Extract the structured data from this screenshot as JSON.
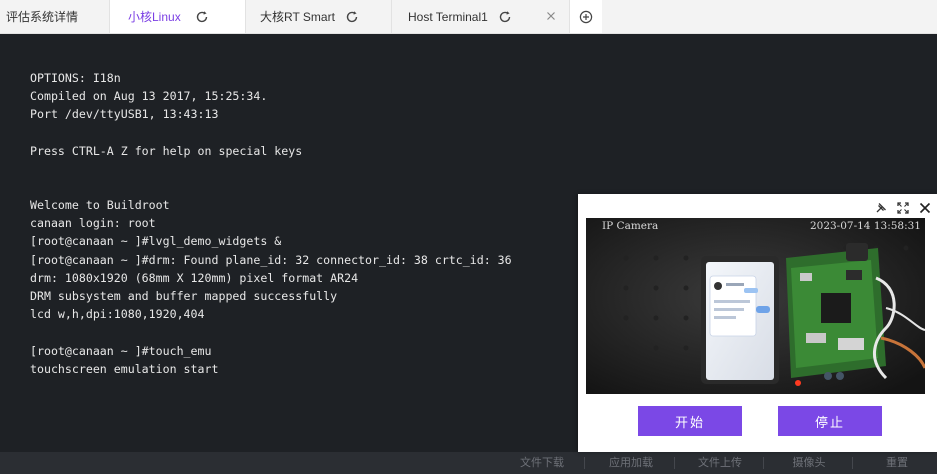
{
  "tabs": [
    {
      "label": "评估系统详情"
    },
    {
      "label": "小核Linux"
    },
    {
      "label": "大核RT Smart"
    },
    {
      "label": "Host Terminal1"
    }
  ],
  "terminal": {
    "lines": [
      "OPTIONS: I18n",
      "Compiled on Aug 13 2017, 15:25:34.",
      "Port /dev/ttyUSB1, 13:43:13",
      "",
      "Press CTRL-A Z for help on special keys",
      "",
      "",
      "Welcome to Buildroot",
      "canaan login: root",
      "[root@canaan ~ ]#lvgl_demo_widgets &",
      "[root@canaan ~ ]#drm: Found plane_id: 32 connector_id: 38 crtc_id: 36",
      "drm: 1080x1920 (68mm X 120mm) pixel format AR24",
      "DRM subsystem and buffer mapped successfully",
      "lcd w,h,dpi:1080,1920,404",
      "",
      "[root@canaan ~ ]#touch_emu",
      "touchscreen emulation start"
    ]
  },
  "camera": {
    "label": "IP Camera",
    "timestamp": "2023-07-14 13:58:31",
    "start_label": "开始",
    "stop_label": "停止"
  },
  "bottom_bar": {
    "items": [
      "文件下载",
      "应用加载",
      "文件上传",
      "摄像头",
      "重置"
    ]
  },
  "colors": {
    "accent": "#7b48e6",
    "active_tab_text": "#7b3fe4",
    "terminal_bg": "#1e2125"
  }
}
